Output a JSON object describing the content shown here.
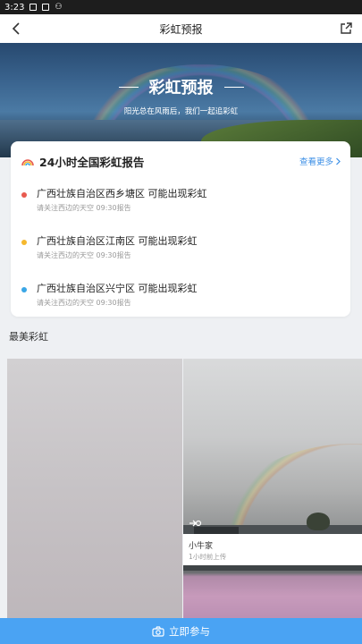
{
  "status_bar": {
    "time": "3:23"
  },
  "nav": {
    "title": "彩虹预报"
  },
  "hero": {
    "title": "彩虹预报",
    "subtitle": "阳光总在风雨后，我们一起追彩虹"
  },
  "report": {
    "title": "24小时全国彩虹报告",
    "more_label": "查看更多",
    "items": [
      {
        "text": "广西壮族自治区西乡塘区 可能出现彩虹",
        "sub": "请关注西边的天空 09:30报告",
        "color": "#e85a4f"
      },
      {
        "text": "广西壮族自治区江南区 可能出现彩虹",
        "sub": "请关注西边的天空 09:30报告",
        "color": "#f5b82e"
      },
      {
        "text": "广西壮族自治区兴宁区 可能出现彩虹",
        "sub": "请关注西边的天空 09:30报告",
        "color": "#3aa6e6"
      }
    ]
  },
  "gallery": {
    "section_title": "最美彩虹",
    "photos": [
      {
        "author": "小牛家",
        "time": "1小时前上传"
      }
    ]
  },
  "bottom_button": {
    "label": "立即参与"
  },
  "colors": {
    "accent": "#3a8ee6",
    "button": "#4aa3f3"
  }
}
